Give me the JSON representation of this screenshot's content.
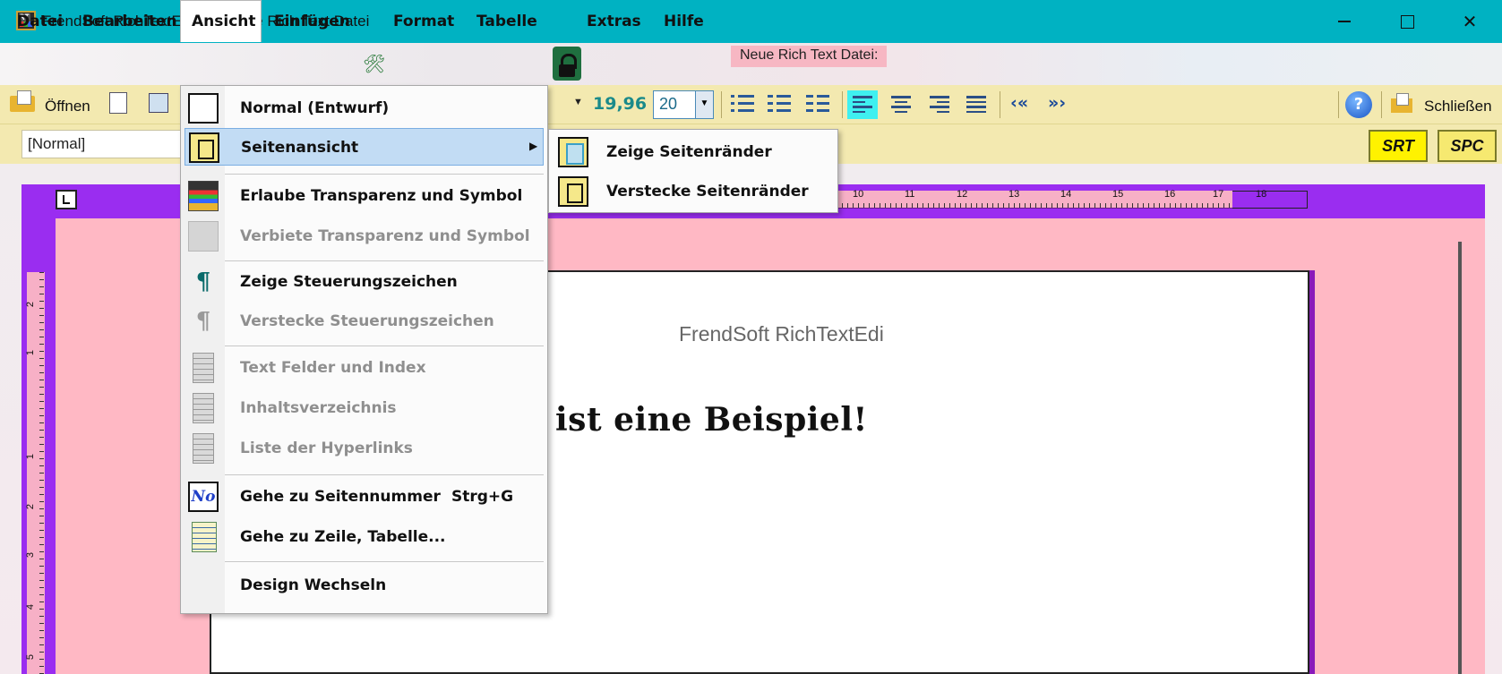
{
  "window": {
    "app_title": "FrendSoft RichTextEdi",
    "doc_title": "Neue Rich Text Datei",
    "minimize_label": "",
    "maximize_label": "",
    "close_label": "✕"
  },
  "menubar": {
    "items": [
      "Datei",
      "Bearbeiten",
      "Ansicht",
      "Einfügen",
      "Format",
      "Tabelle",
      "Extras",
      "Hilfe"
    ],
    "active": "Ansicht",
    "doc_label": "Neue Rich Text Datei:"
  },
  "toolbar": {
    "open_label": "Öffnen",
    "font_size_value": "19,96",
    "font_size_input": "20",
    "close_label": "Schließen",
    "help_glyph": "?",
    "indent_decrease": "‹«",
    "indent_increase": "»›"
  },
  "toolbar2": {
    "style_value": "[Normal]",
    "srt_label": "SRT",
    "spc_label": "SPC"
  },
  "ruler": {
    "h_numbers": [
      "10",
      "11",
      "12",
      "13",
      "14",
      "15",
      "16",
      "17",
      "18"
    ],
    "v_numbers": [
      "2",
      "1",
      "1",
      "2",
      "3",
      "4",
      "5"
    ]
  },
  "document": {
    "header_text": "FrendSoft RichTextEdi",
    "body_text": "ist eine Beispiel!"
  },
  "ansicht_menu": {
    "items": [
      {
        "label": "Normal (Entwurf)",
        "icon": "page-frame-icon",
        "enabled": true
      },
      {
        "label": "Seitenansicht",
        "icon": "page-view-icon",
        "enabled": true,
        "has_submenu": true,
        "highlighted": true
      },
      {
        "label": "Erlaube Transparenz und Symbol",
        "icon": "app-logo-icon",
        "enabled": true
      },
      {
        "label": "Verbiete Transparenz und Symbol",
        "icon": "app-logo-gray-icon",
        "enabled": false
      },
      {
        "label": "Zeige Steuerungszeichen",
        "icon": "pilcrow-icon",
        "enabled": true
      },
      {
        "label": "Verstecke Steuerungszeichen",
        "icon": "pilcrow-gray-icon",
        "enabled": false
      },
      {
        "label": "Text Felder und Index",
        "icon": "document-icon",
        "enabled": false
      },
      {
        "label": "Inhaltsverzeichnis",
        "icon": "document-icon",
        "enabled": false
      },
      {
        "label": "Liste der Hyperlinks",
        "icon": "document-icon",
        "enabled": false
      },
      {
        "label": "Gehe zu Seitennummer",
        "shortcut": "Strg+G",
        "icon": "number-icon",
        "enabled": true
      },
      {
        "label": "Gehe zu Zeile, Tabelle...",
        "icon": "goto-line-icon",
        "enabled": true
      },
      {
        "label": "Design Wechseln",
        "icon": "",
        "enabled": true
      }
    ],
    "submenu_arrow": "▶"
  },
  "seitenansicht_submenu": {
    "items": [
      {
        "label": "Zeige Seitenränder",
        "icon": "show-margins-icon"
      },
      {
        "label": "Verstecke Seitenränder",
        "icon": "hide-margins-icon"
      }
    ]
  },
  "colors": {
    "titlebar": "#00b2c2",
    "toolbar": "#f3e9b0",
    "ruler": "#9a2df0",
    "page_bg": "#ffb8c4",
    "menu_highlight": "#c2dcf4"
  }
}
